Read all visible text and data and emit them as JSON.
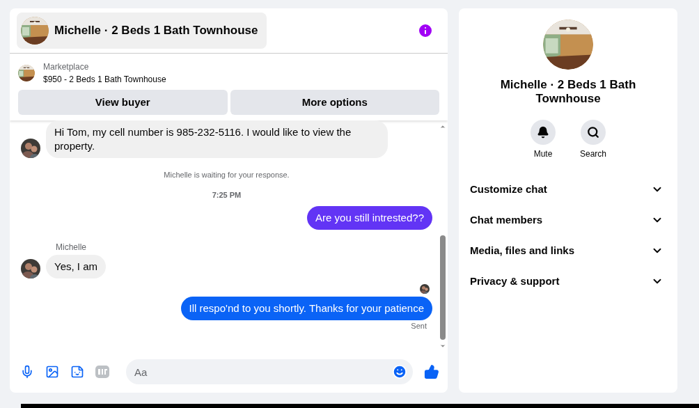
{
  "header": {
    "title": "Michelle · 2 Beds 1 Bath Townhouse"
  },
  "listing": {
    "source": "Marketplace",
    "title": "$950 - 2 Beds 1 Bath Townhouse",
    "buttons": [
      "View buyer",
      "More options"
    ]
  },
  "messages": [
    {
      "kind": "incoming",
      "text": "Hi Tom, my cell number is 985-232-5116. I would like to view the property."
    },
    {
      "kind": "notice",
      "text": "Michelle is waiting for your response."
    },
    {
      "kind": "time",
      "text": "7:25 PM"
    },
    {
      "kind": "outgoing",
      "text": "Are you still intrested??",
      "color": "#6234f5"
    },
    {
      "kind": "sender",
      "text": "Michelle"
    },
    {
      "kind": "incoming",
      "text": "Yes, I am"
    },
    {
      "kind": "seen"
    },
    {
      "kind": "outgoing",
      "text": "Ill respo'nd to you shortly. Thanks for your patience",
      "color": "#0a63f6"
    },
    {
      "kind": "status",
      "text": "Sent"
    }
  ],
  "composer": {
    "placeholder": "Aa"
  },
  "profile": {
    "title": "Michelle · 2 Beds 1 Bath Townhouse",
    "actions": [
      {
        "kind": "mute",
        "label": "Mute"
      },
      {
        "kind": "search",
        "label": "Search"
      }
    ],
    "sections": [
      {
        "label": "Customize chat",
        "expanded": false
      },
      {
        "label": "Chat members",
        "expanded": false
      },
      {
        "label": "Media, files and links",
        "expanded": false
      },
      {
        "label": "Privacy & support",
        "expanded": false
      }
    ]
  }
}
